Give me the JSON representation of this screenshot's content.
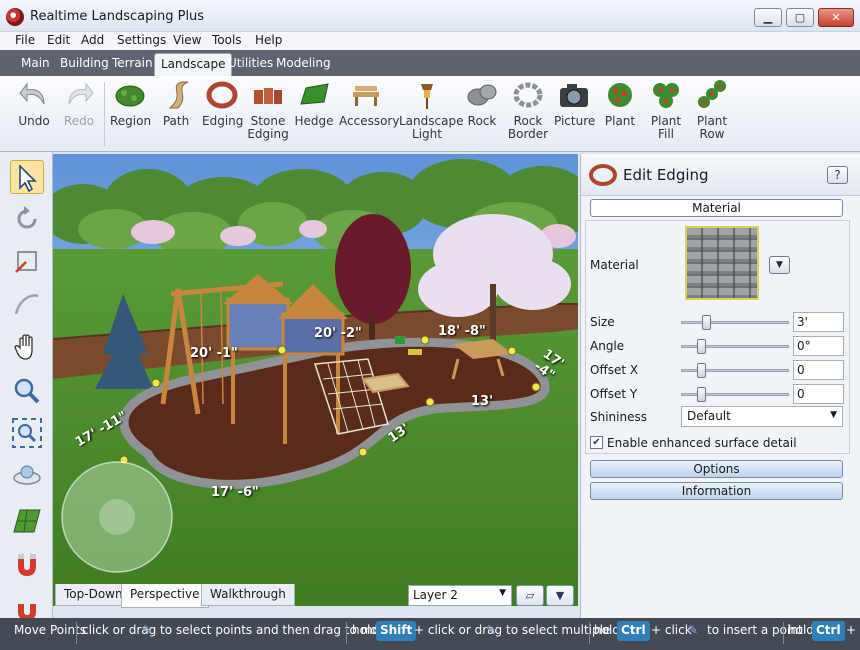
{
  "window": {
    "title": "Realtime Landscaping Plus",
    "controls": {
      "minimize": "▁",
      "maximize": "▢",
      "close": "✕"
    }
  },
  "menu": [
    "File",
    "Edit",
    "Add",
    "Settings",
    "View",
    "Tools",
    "Help"
  ],
  "tabs": [
    "Main",
    "Building",
    "Terrain",
    "Landscape",
    "Utilities",
    "Modeling"
  ],
  "active_tab": "Landscape",
  "toolbar": {
    "undo": "Undo",
    "redo": "Redo",
    "region": "Region",
    "path": "Path",
    "edging": "Edging",
    "stone_edging": [
      "Stone",
      "Edging"
    ],
    "hedge": "Hedge",
    "accessory": "Accessory",
    "landscape_light": [
      "Landscape",
      "Light"
    ],
    "rock": "Rock",
    "rock_border": [
      "Rock",
      "Border"
    ],
    "picture": "Picture",
    "plant": "Plant",
    "plant_fill": [
      "Plant",
      "Fill"
    ],
    "plant_row": [
      "Plant",
      "Row"
    ]
  },
  "left_tools": [
    "select-arrow-icon",
    "rotate-icon",
    "resize-icon",
    "curve-icon",
    "pan-hand-icon",
    "zoom-icon",
    "zoom-extents-icon",
    "orbit-icon",
    "grid-icon",
    "snap-magnet-icon",
    "magnet-icon"
  ],
  "viewport": {
    "dimensions": [
      "20' -1\"",
      "20' -2\"",
      "18' -8\"",
      "17' -4\"",
      "17' -11\"",
      "13'",
      "13'",
      "17' -6\""
    ],
    "view_tabs": [
      "Top-Down",
      "Perspective",
      "Walkthrough"
    ],
    "active_view": "Perspective",
    "layer": "Layer 2"
  },
  "panel": {
    "title": "Edit Edging",
    "help": "?",
    "material_section": "Material",
    "material_label": "Material",
    "size_label": "Size",
    "size_value": "3'",
    "size_slider": 0.2,
    "angle_label": "Angle",
    "angle_value": "0°",
    "angle_slider": 0.15,
    "offset_x_label": "Offset X",
    "offset_x_value": "0",
    "offset_x_slider": 0.15,
    "offset_y_label": "Offset Y",
    "offset_y_value": "0",
    "offset_y_slider": 0.15,
    "shininess_label": "Shininess",
    "shininess_value": "Default",
    "enhanced_label": "Enable enhanced surface detail",
    "enhanced_checked": true,
    "options_button": "Options",
    "information_button": "Information"
  },
  "status": {
    "mode": "Move Points",
    "hint1": "click or drag",
    "hint1b": "to select points and then drag to move",
    "hold1": "hold",
    "key1": "Shift",
    "hint2": "+ click or drag",
    "hint2b": "to select multiple",
    "hold2": "hold",
    "key2": "Ctrl",
    "hint3": "+ click",
    "hint3b": "to insert a point",
    "hold3": "hold",
    "key3": "Ctrl",
    "hint4": "+"
  }
}
